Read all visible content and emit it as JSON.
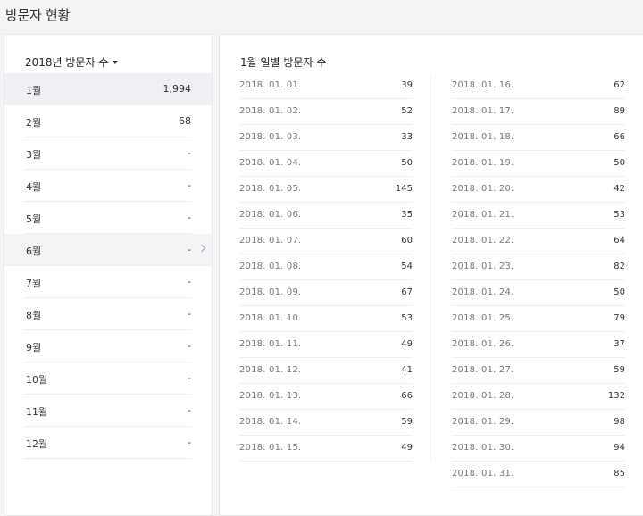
{
  "page": {
    "title": "방문자 현황"
  },
  "left": {
    "year_select_label": "2018년 방문자 수",
    "months": [
      {
        "label": "1월",
        "value": "1,994",
        "state": "selected"
      },
      {
        "label": "2월",
        "value": "68",
        "state": ""
      },
      {
        "label": "3월",
        "value": "-",
        "state": ""
      },
      {
        "label": "4월",
        "value": "-",
        "state": ""
      },
      {
        "label": "5월",
        "value": "-",
        "state": ""
      },
      {
        "label": "6월",
        "value": "-",
        "state": "hover"
      },
      {
        "label": "7월",
        "value": "-",
        "state": ""
      },
      {
        "label": "8월",
        "value": "-",
        "state": ""
      },
      {
        "label": "9월",
        "value": "-",
        "state": ""
      },
      {
        "label": "10월",
        "value": "-",
        "state": ""
      },
      {
        "label": "11월",
        "value": "-",
        "state": ""
      },
      {
        "label": "12월",
        "value": "-",
        "state": ""
      }
    ]
  },
  "right": {
    "title": "1월 일별 방문자 수",
    "days": [
      {
        "date": "2018. 01. 01.",
        "value": "39"
      },
      {
        "date": "2018. 01. 02.",
        "value": "52"
      },
      {
        "date": "2018. 01. 03.",
        "value": "33"
      },
      {
        "date": "2018. 01. 04.",
        "value": "50"
      },
      {
        "date": "2018. 01. 05.",
        "value": "145"
      },
      {
        "date": "2018. 01. 06.",
        "value": "35"
      },
      {
        "date": "2018. 01. 07.",
        "value": "60"
      },
      {
        "date": "2018. 01. 08.",
        "value": "54"
      },
      {
        "date": "2018. 01. 09.",
        "value": "67"
      },
      {
        "date": "2018. 01. 10.",
        "value": "53"
      },
      {
        "date": "2018. 01. 11.",
        "value": "49"
      },
      {
        "date": "2018. 01. 12.",
        "value": "41"
      },
      {
        "date": "2018. 01. 13.",
        "value": "66"
      },
      {
        "date": "2018. 01. 14.",
        "value": "59"
      },
      {
        "date": "2018. 01. 15.",
        "value": "49"
      },
      {
        "date": "2018. 01. 16.",
        "value": "62"
      },
      {
        "date": "2018. 01. 17.",
        "value": "89"
      },
      {
        "date": "2018. 01. 18.",
        "value": "66"
      },
      {
        "date": "2018. 01. 19.",
        "value": "50"
      },
      {
        "date": "2018. 01. 20.",
        "value": "42"
      },
      {
        "date": "2018. 01. 21.",
        "value": "53"
      },
      {
        "date": "2018. 01. 22.",
        "value": "64"
      },
      {
        "date": "2018. 01. 23.",
        "value": "82"
      },
      {
        "date": "2018. 01. 24.",
        "value": "50"
      },
      {
        "date": "2018. 01. 25.",
        "value": "79"
      },
      {
        "date": "2018. 01. 26.",
        "value": "37"
      },
      {
        "date": "2018. 01. 27.",
        "value": "59"
      },
      {
        "date": "2018. 01. 28.",
        "value": "132"
      },
      {
        "date": "2018. 01. 29.",
        "value": "98"
      },
      {
        "date": "2018. 01. 30.",
        "value": "94"
      },
      {
        "date": "2018. 01. 31.",
        "value": "85"
      }
    ]
  },
  "colors": {
    "selected_bg": "#eef0f3",
    "border": "#e3e5e8"
  }
}
